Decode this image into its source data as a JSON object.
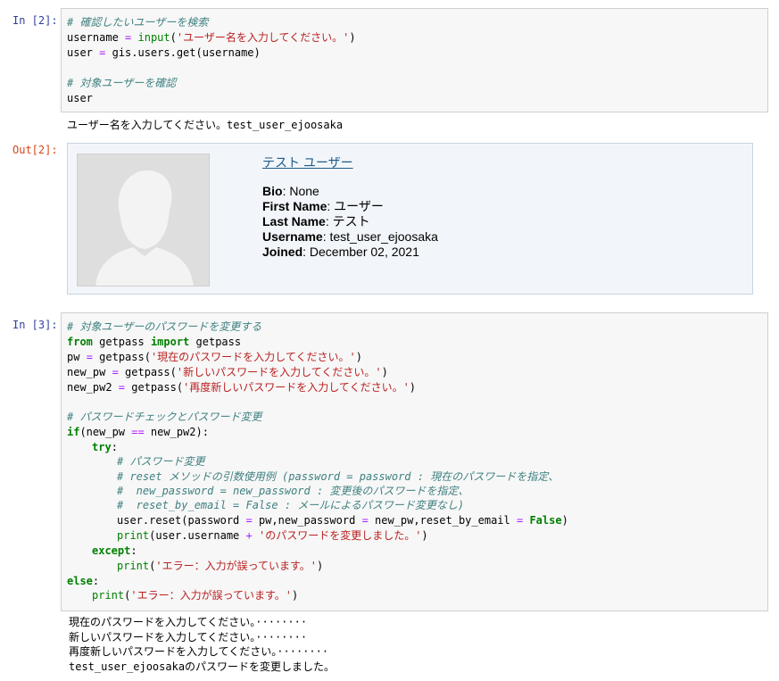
{
  "cell2": {
    "in_prompt": "In [2]:",
    "out_prompt": "Out[2]:",
    "code": {
      "c1": "# 確認したいユーザーを検索",
      "l2a": "username ",
      "l2op": "=",
      "l2b": " ",
      "l2fn": "input",
      "l2c": "(",
      "l2str": "'ユーザー名を入力してください。'",
      "l2d": ")",
      "l3a": "user ",
      "l3op": "=",
      "l3b": " gis.users.get(username)",
      "c2": "# 対象ユーザーを確認",
      "l5": "user"
    },
    "stdout": "ユーザー名を入力してください。test_user_ejoosaka",
    "user_card": {
      "title": "テスト ユーザー",
      "fields": [
        {
          "label": "Bio",
          "value": ": None"
        },
        {
          "label": "First Name",
          "value": ": ユーザー"
        },
        {
          "label": "Last Name",
          "value": ": テスト"
        },
        {
          "label": "Username",
          "value": ": test_user_ejoosaka"
        },
        {
          "label": "Joined",
          "value": ": December 02, 2021"
        }
      ]
    }
  },
  "cell3": {
    "in_prompt": "In [3]:",
    "code": {
      "c1": "# 対象ユーザーのパスワードを変更する",
      "l2kw1": "from",
      "l2a": " getpass ",
      "l2kw2": "import",
      "l2b": " getpass",
      "l3a": "pw ",
      "l3op": "=",
      "l3b": " getpass(",
      "l3str": "'現在のパスワードを入力してください。'",
      "l3c": ")",
      "l4a": "new_pw ",
      "l4op": "=",
      "l4b": " getpass(",
      "l4str": "'新しいパスワードを入力してください。'",
      "l4c": ")",
      "l5a": "new_pw2 ",
      "l5op": "=",
      "l5b": " getpass(",
      "l5str": "'再度新しいパスワードを入力してください。'",
      "l5c": ")",
      "c2": "# パスワードチェックとパスワード変更",
      "l8kw": "if",
      "l8a": "(new_pw ",
      "l8op": "==",
      "l8b": " new_pw2):",
      "l9kw": "try",
      "l9b": ":",
      "c3": "# パスワード変更",
      "c4": "# reset メソッドの引数使用例 (password = password : 現在のパスワードを指定、",
      "c5": "#  new_password = new_password : 変更後のパスワードを指定、",
      "c6": "#  reset_by_email = False : メールによるパスワード変更なし)",
      "l14a": "user.reset(password ",
      "l14op1": "=",
      "l14b": " pw,new_password ",
      "l14op2": "=",
      "l14c": " new_pw,reset_by_email ",
      "l14op3": "=",
      "l14d": " ",
      "l14kw": "False",
      "l14e": ")",
      "l15fn": "print",
      "l15a": "(user.username ",
      "l15op": "+",
      "l15b": " ",
      "l15str": "'のパスワードを変更しました。'",
      "l15c": ")",
      "l16kw": "except",
      "l16b": ":",
      "l17fn": "print",
      "l17a": "(",
      "l17str": "'エラー：入力が誤っています。'",
      "l17b": ")",
      "l18kw": "else",
      "l18b": ":",
      "l19fn": "print",
      "l19a": "(",
      "l19str": "'エラー：入力が誤っています。'",
      "l19b": ")"
    },
    "stdout": [
      "現在のパスワードを入力してください。········",
      "新しいパスワードを入力してください。········",
      "再度新しいパスワードを入力してください。········",
      "test_user_ejoosakaのパスワードを変更しました。"
    ]
  }
}
